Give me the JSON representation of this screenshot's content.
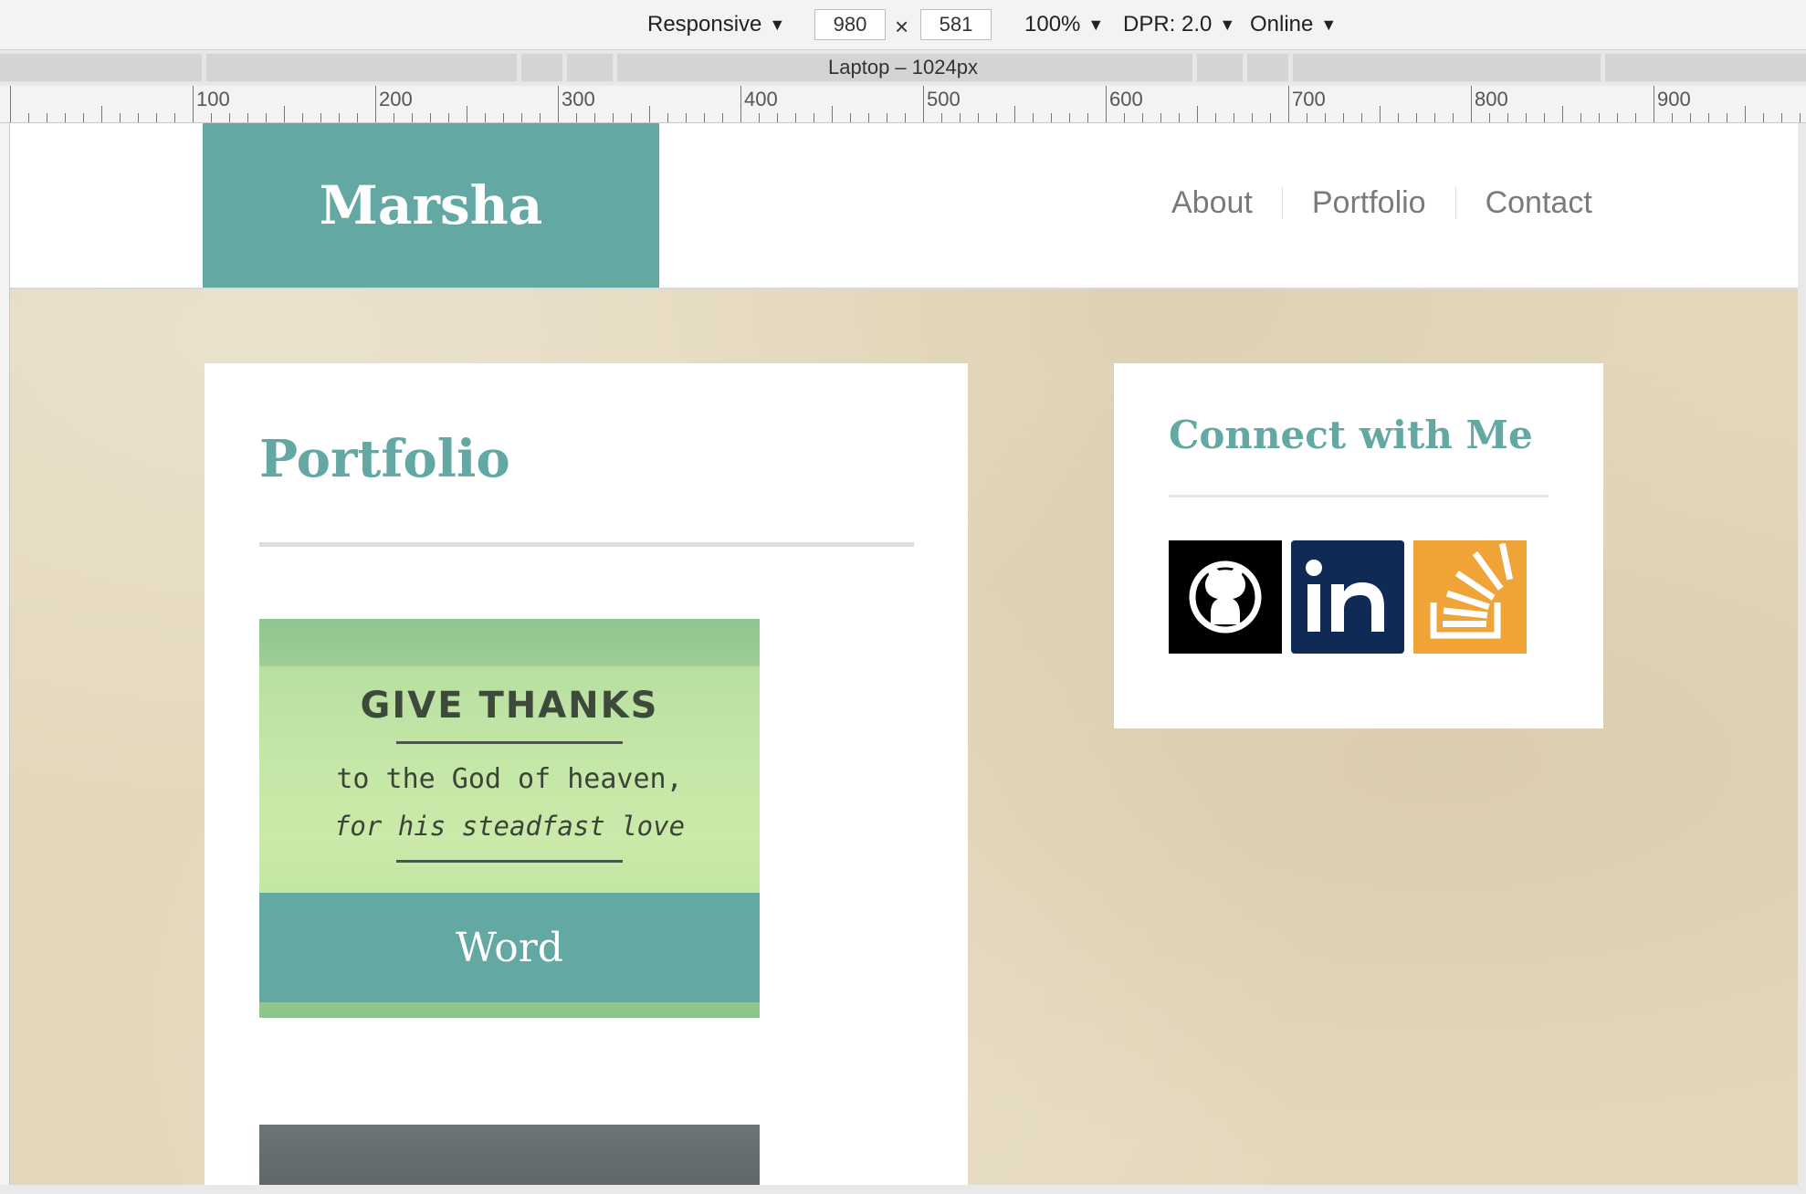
{
  "devtools": {
    "device_label": "Responsive",
    "width_value": "980",
    "height_value": "581",
    "times_symbol": "×",
    "zoom_label": "100%",
    "dpr_label": "DPR: 2.0",
    "network_label": "Online",
    "media_query_label": "Laptop – 1024px",
    "ruler_labels": [
      "100",
      "200",
      "300",
      "400",
      "500",
      "600",
      "700",
      "800",
      "900"
    ]
  },
  "site": {
    "logo": "Marsha",
    "nav": [
      "About",
      "Portfolio",
      "Contact"
    ],
    "main": {
      "title": "Portfolio",
      "item": {
        "thumb_line1": "GIVE THANKS",
        "thumb_line2": "to the God of heaven,",
        "thumb_line3": "for his steadfast love",
        "caption": "Word"
      }
    },
    "sidebar": {
      "title": "Connect with Me",
      "social": [
        {
          "name": "github",
          "icon": "github-icon",
          "color": "#000000"
        },
        {
          "name": "linkedin",
          "icon": "linkedin-icon",
          "color": "#0f2a55"
        },
        {
          "name": "stackoverflow",
          "icon": "stackoverflow-icon",
          "color": "#f0a336"
        }
      ]
    },
    "colors": {
      "accent": "#63a8a2",
      "background": "#e4d8bc"
    }
  }
}
